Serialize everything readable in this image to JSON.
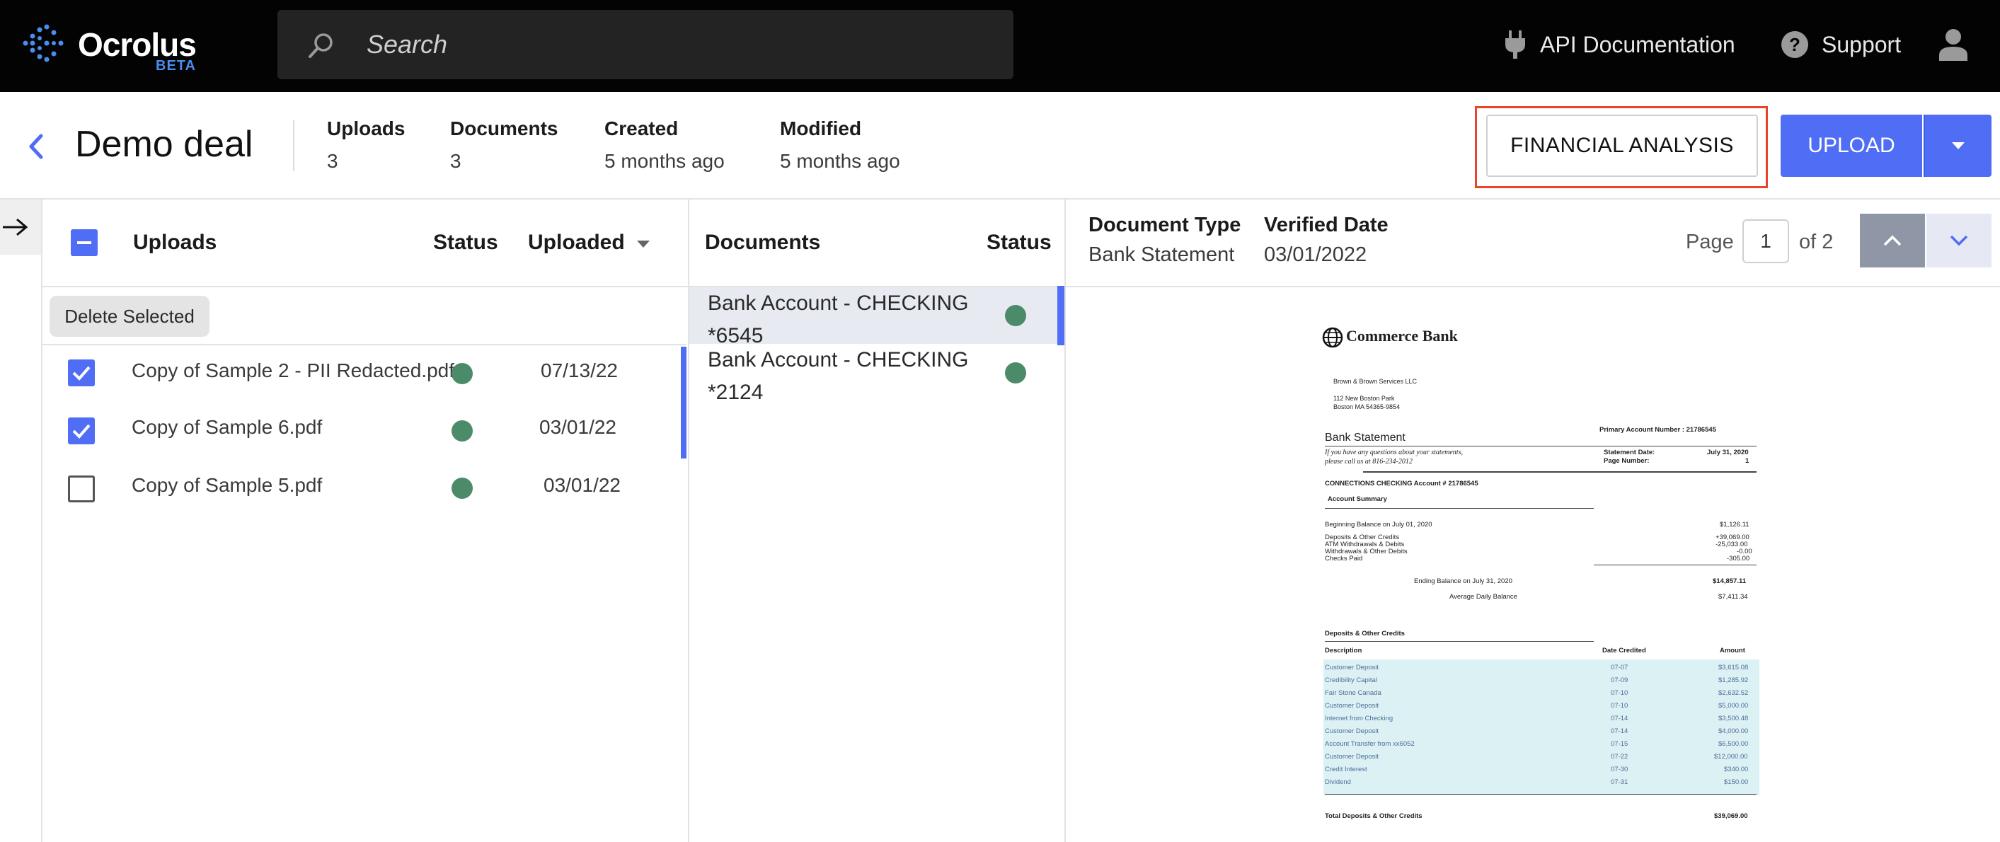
{
  "app": {
    "logo_text": "Ocrolus",
    "logo_badge": "BETA"
  },
  "topbar": {
    "search_placeholder": "Search",
    "api_docs_label": "API Documentation",
    "support_label": "Support"
  },
  "deal": {
    "title": "Demo deal",
    "meta": [
      {
        "label": "Uploads",
        "value": "3"
      },
      {
        "label": "Documents",
        "value": "3"
      },
      {
        "label": "Created",
        "value": "5 months ago"
      },
      {
        "label": "Modified",
        "value": "5 months ago"
      }
    ],
    "financial_analysis_label": "FINANCIAL ANALYSIS",
    "upload_label": "UPLOAD",
    "highlight_color": "#e8452c",
    "accent_color": "#4f6ef5"
  },
  "uploads_panel": {
    "col_uploads": "Uploads",
    "col_status": "Status",
    "col_uploaded": "Uploaded",
    "delete_selected_label": "Delete Selected",
    "rows": [
      {
        "name": "Copy of Sample 2 - PII Redacted.pdf",
        "date": "07/13/22",
        "checked": true,
        "status": "green"
      },
      {
        "name": "Copy of Sample 6.pdf",
        "date": "03/01/22",
        "checked": true,
        "status": "green"
      },
      {
        "name": "Copy of Sample 5.pdf",
        "date": "03/01/22",
        "checked": false,
        "status": "green"
      }
    ]
  },
  "documents_panel": {
    "col_documents": "Documents",
    "col_status": "Status",
    "rows": [
      {
        "name": "Bank Account - CHECKING *6545",
        "selected": true,
        "status": "green"
      },
      {
        "name": "Bank Account - CHECKING *2124",
        "selected": false,
        "status": "green"
      }
    ]
  },
  "viewer": {
    "doc_type_label": "Document Type",
    "doc_type_value": "Bank Statement",
    "verified_label": "Verified Date",
    "verified_value": "03/01/2022",
    "page_label": "Page",
    "page_current": "1",
    "page_of": "of 2"
  },
  "statement": {
    "bank_name": "Commerce Bank",
    "company": "Brown & Brown Services LLC",
    "address_1": "112 New Boston Park",
    "address_2": "Boston MA 54365-9854",
    "primary_account": "Primary Account Number : 21786545",
    "title": "Bank Statement",
    "question_1": "If you have any questions about your statements,",
    "question_2": "please call us at 816-234-2012",
    "statement_date_label": "Statement Date:",
    "statement_date_value": "July 31, 2020",
    "page_number_label": "Page Number:",
    "page_number_value": "1",
    "account_line": "CONNECTIONS CHECKING    Account # 21786545",
    "summary_title": "Account Summary",
    "summary": [
      {
        "label": "Beginning Balance on July 01, 2020",
        "value": "$1,126.11"
      },
      {
        "label": "Deposits & Other Credits",
        "value": "+39,069.00"
      },
      {
        "label": "ATM Withdrawals & Debits",
        "value": "-25,033.00"
      },
      {
        "label": "Withdrawals & Other Debits",
        "value": "-0.00"
      },
      {
        "label": "Checks Paid",
        "value": "-305.00"
      }
    ],
    "ending_label": "Ending Balance on July 31, 2020",
    "ending_value": "$14,857.11",
    "avg_label": "Average Daily Balance",
    "avg_value": "$7,411.34",
    "credits_title": "Deposits & Other Credits",
    "col_description": "Description",
    "col_date": "Date Credited",
    "col_amount": "Amount",
    "credits": [
      {
        "desc": "Customer Deposit",
        "date": "07-07",
        "amount": "$3,615.08"
      },
      {
        "desc": "Credibility Capital",
        "date": "07-09",
        "amount": "$1,285.92"
      },
      {
        "desc": "Fair Stone Canada",
        "date": "07-10",
        "amount": "$2,632.52"
      },
      {
        "desc": "Customer Deposit",
        "date": "07-10",
        "amount": "$5,000.00"
      },
      {
        "desc": "Internet from Checking",
        "date": "07-14",
        "amount": "$3,500.48"
      },
      {
        "desc": "Customer Deposit",
        "date": "07-14",
        "amount": "$4,000.00"
      },
      {
        "desc": "Account Transfer from xx6052",
        "date": "07-15",
        "amount": "$6,500.00"
      },
      {
        "desc": "Customer Deposit",
        "date": "07-22",
        "amount": "$12,000.00"
      },
      {
        "desc": "Credit Interest",
        "date": "07-30",
        "amount": "$340.00"
      },
      {
        "desc": "Dividend",
        "date": "07-31",
        "amount": "$150.00"
      }
    ],
    "total_label": "Total Deposits & Other Credits",
    "total_value": "$39,069.00"
  }
}
